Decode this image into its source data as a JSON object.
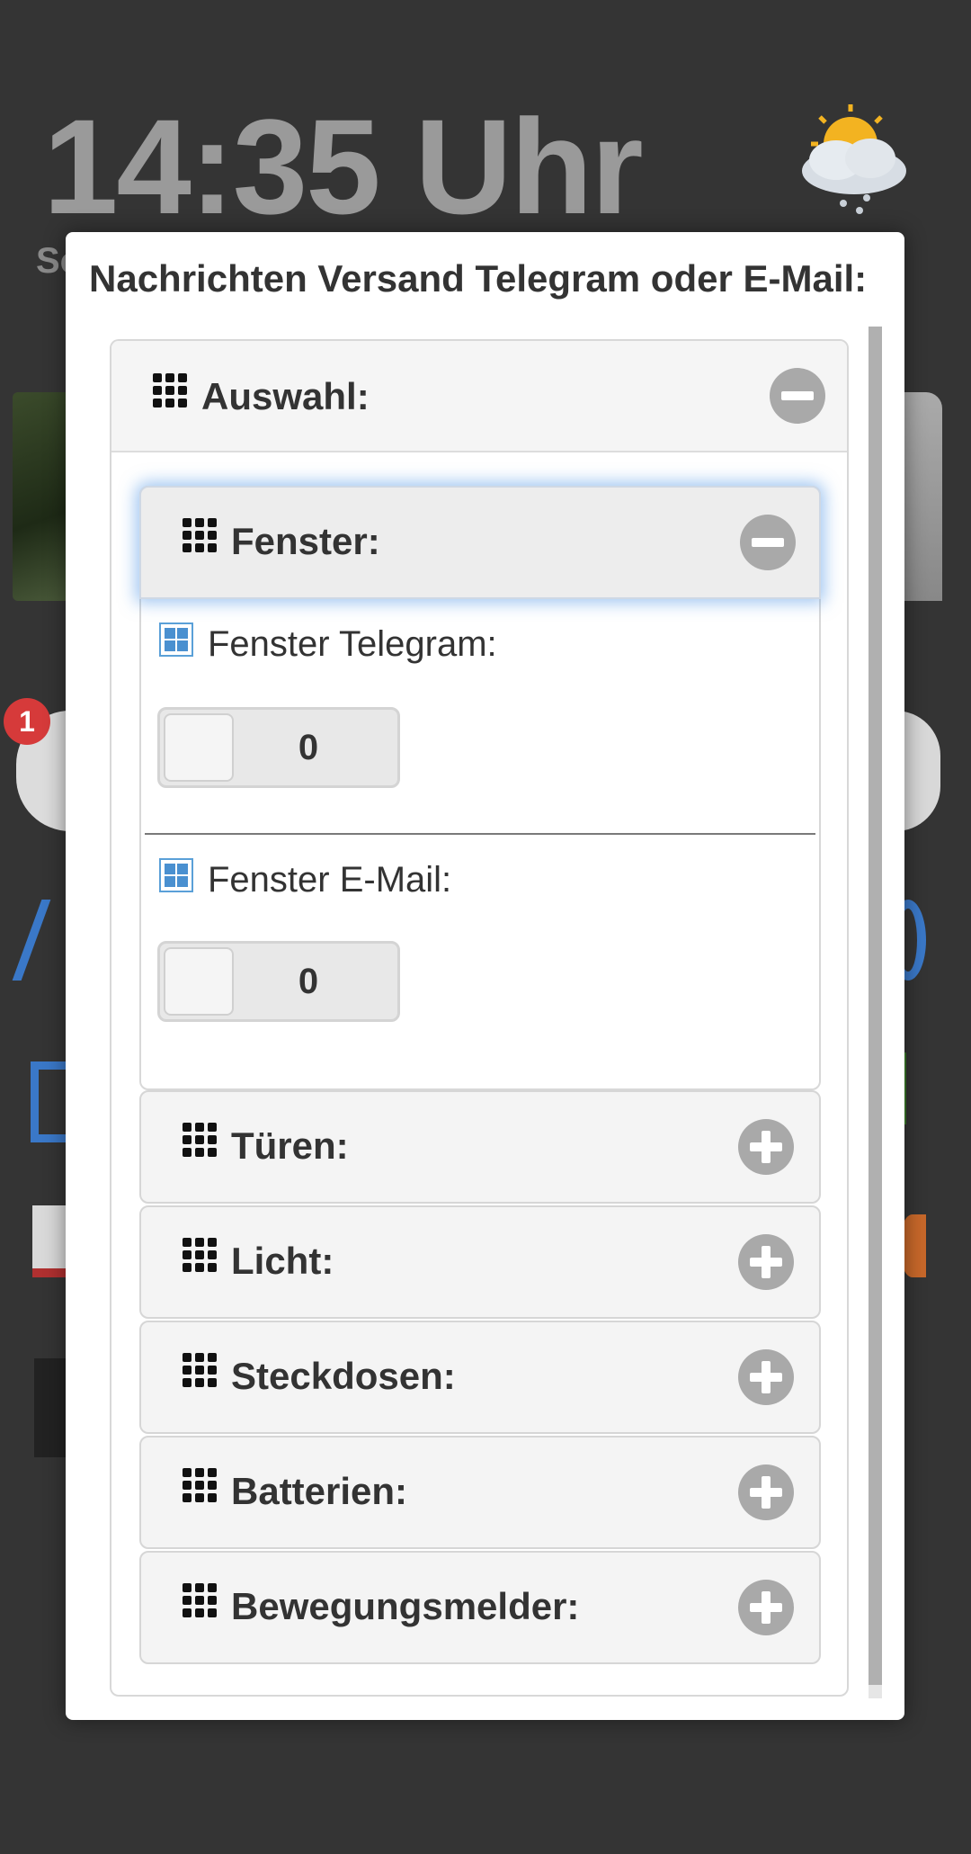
{
  "background": {
    "clock": "14:35 Uhr",
    "date_fragment": "So",
    "notification_badge": "1"
  },
  "dialog": {
    "title": "Nachrichten Versand Telegram oder E-Mail:",
    "outer_section": {
      "label": "Auswahl:",
      "state": "expanded"
    },
    "fenster": {
      "label": "Fenster:",
      "state": "expanded",
      "fields": [
        {
          "label": "Fenster Telegram:",
          "value": "0"
        },
        {
          "label": "Fenster E-Mail:",
          "value": "0"
        }
      ]
    },
    "collapsed_sections": [
      {
        "label": "Türen:"
      },
      {
        "label": "Licht:"
      },
      {
        "label": "Steckdosen:"
      },
      {
        "label": "Batterien:"
      },
      {
        "label": "Bewegungsmelder:"
      }
    ]
  },
  "colors": {
    "backdrop": "#343434",
    "header_bg": "#f5f5f5",
    "round_button": "#a9a9a9",
    "focus_glow": "#5096e6",
    "field_icon": "#4a90d0"
  },
  "icons": {
    "section": "grid-icon",
    "expanded": "minus-circle-icon",
    "collapsed": "plus-circle-icon",
    "field": "window-icon"
  }
}
